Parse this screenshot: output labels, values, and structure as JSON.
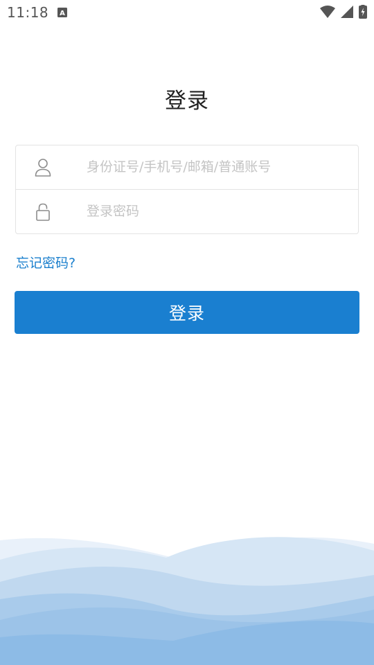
{
  "status_bar": {
    "time": "11:18",
    "keyboard_indicator": "A",
    "icons": [
      "wifi-icon",
      "cell-signal-icon",
      "battery-charging-icon"
    ]
  },
  "page": {
    "title": "登录"
  },
  "form": {
    "account": {
      "icon": "user-icon",
      "placeholder": "身份证号/手机号/邮箱/普通账号",
      "value": ""
    },
    "password": {
      "icon": "lock-icon",
      "placeholder": "登录密码",
      "value": ""
    },
    "forgot_label": "忘记密码?",
    "submit_label": "登录"
  },
  "colors": {
    "accent": "#1a7fd0",
    "link": "#1a7fcd",
    "wave_light": "#dbe9f6",
    "wave_dark": "#8dbbe6"
  }
}
